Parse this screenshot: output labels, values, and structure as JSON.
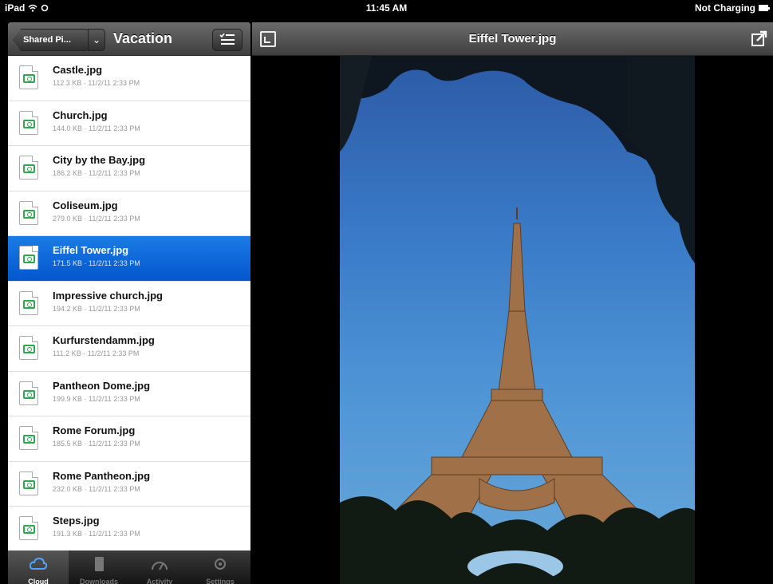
{
  "status_bar": {
    "device": "iPad",
    "time": "11:45 AM",
    "battery_status": "Not Charging"
  },
  "sidebar": {
    "back_label": "Shared Pi...",
    "title": "Vacation",
    "files": [
      {
        "name": "Castle.jpg",
        "meta": "112.3 KB · 11/2/11 2:33 PM",
        "selected": false
      },
      {
        "name": "Church.jpg",
        "meta": "144.0 KB · 11/2/11 2:33 PM",
        "selected": false
      },
      {
        "name": "City by the Bay.jpg",
        "meta": "186.2 KB · 11/2/11 2:33 PM",
        "selected": false
      },
      {
        "name": "Coliseum.jpg",
        "meta": "279.0 KB · 11/2/11 2:33 PM",
        "selected": false
      },
      {
        "name": "Eiffel Tower.jpg",
        "meta": "171.5 KB · 11/2/11 2:33 PM",
        "selected": true
      },
      {
        "name": "Impressive church.jpg",
        "meta": "194.2 KB · 11/2/11 2:33 PM",
        "selected": false
      },
      {
        "name": "Kurfurstendamm.jpg",
        "meta": "111.2 KB · 11/2/11 2:33 PM",
        "selected": false
      },
      {
        "name": "Pantheon Dome.jpg",
        "meta": "199.9 KB · 11/2/11 2:33 PM",
        "selected": false
      },
      {
        "name": "Rome Forum.jpg",
        "meta": "185.5 KB · 11/2/11 2:33 PM",
        "selected": false
      },
      {
        "name": "Rome Pantheon.jpg",
        "meta": "232.0 KB · 11/2/11 2:33 PM",
        "selected": false
      },
      {
        "name": "Steps.jpg",
        "meta": "191.3 KB · 11/2/11 2:33 PM",
        "selected": false
      }
    ],
    "tabs": [
      {
        "label": "Cloud",
        "icon": "cloud-icon",
        "active": true
      },
      {
        "label": "Downloads",
        "icon": "ipad-icon",
        "active": false
      },
      {
        "label": "Activity",
        "icon": "speedometer-icon",
        "active": false
      },
      {
        "label": "Settings",
        "icon": "gear-icon",
        "active": false
      }
    ]
  },
  "viewer": {
    "title": "Eiffel Tower.jpg",
    "image_subject": "eiffel-tower-photo"
  },
  "colors": {
    "selection_blue": "#0a64d8",
    "file_icon_green": "#2fa84f",
    "sky_blue": "#3a7bc8"
  }
}
